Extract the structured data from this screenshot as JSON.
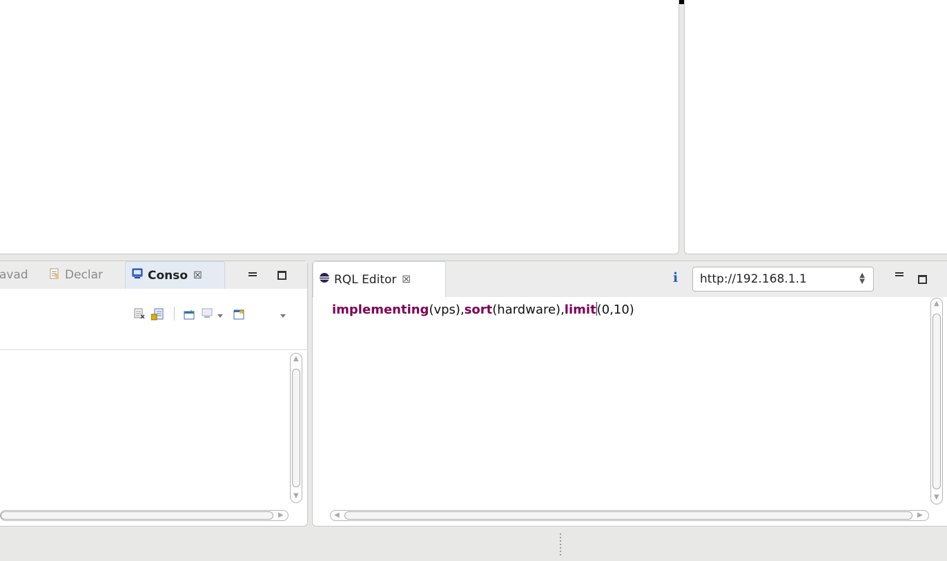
{
  "left_panel": {
    "tabs": [
      {
        "label": "avad",
        "state": "inactive"
      },
      {
        "label": "Declar",
        "icon": "declaration-icon",
        "state": "inactive"
      },
      {
        "label": "Conso",
        "icon": "console-icon",
        "state": "active",
        "close": "☒"
      }
    ],
    "toolbar_icons": [
      "clear-console-icon",
      "scroll-lock-icon",
      "pin-console-icon",
      "display-selected-console-icon",
      "open-console-icon"
    ]
  },
  "editor_panel": {
    "tab": {
      "label": "RQL Editor",
      "close": "☒",
      "icon": "eclipse-icon"
    },
    "info_label": "i",
    "server_url": "http://192.168.1.1",
    "code": {
      "t1": "implementing",
      "t2": "(vps),",
      "t3": "sort",
      "t4": "(hardware),",
      "t5": "limit",
      "t6": "(0,10)"
    }
  },
  "colors": {
    "keyword": "#7f0055",
    "active_tab": "#e4ebf3",
    "background": "#e8e8e7"
  }
}
